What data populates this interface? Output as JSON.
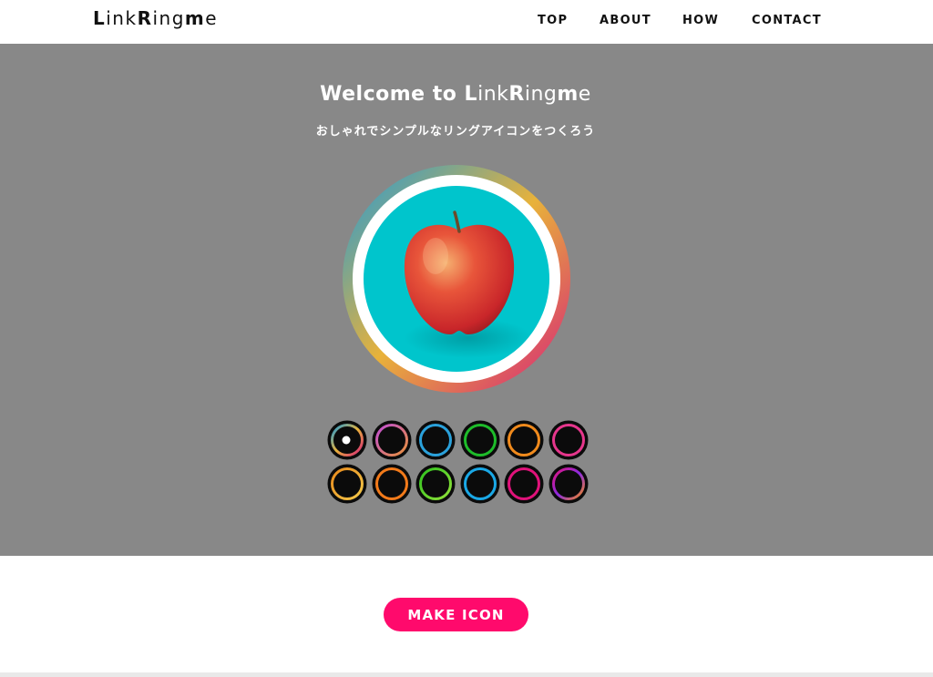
{
  "header": {
    "logo_parts": [
      "L",
      "ink",
      "R",
      "ing",
      "m",
      "e"
    ],
    "nav": [
      {
        "key": "top",
        "label": "TOP"
      },
      {
        "key": "about",
        "label": "ABOUT"
      },
      {
        "key": "how",
        "label": "HOW"
      },
      {
        "key": "contact",
        "label": "CONTACT"
      }
    ]
  },
  "hero": {
    "title_prefix": "Welcome to ",
    "title_parts": [
      "L",
      "ink",
      "R",
      "ing",
      "m",
      "e"
    ],
    "subtitle": "おしゃれでシンプルなリングアイコンをつくろう",
    "preview": {
      "image": "apple-on-teal-background",
      "ring_colors": [
        "#1e9ad9",
        "#e8b23a",
        "#d6207a"
      ],
      "background": "#00c5cc"
    },
    "swatches": [
      [
        {
          "colors": [
            "#1e9ad9",
            "#e8b23a",
            "#d6207a"
          ],
          "selected": true
        },
        {
          "colors": [
            "#c04ed6",
            "#e9913a"
          ],
          "selected": false
        },
        {
          "colors": [
            "#2aa1db",
            "#2aa1db"
          ],
          "selected": false
        },
        {
          "colors": [
            "#1ebc2a",
            "#1ebc2a"
          ],
          "selected": false
        },
        {
          "colors": [
            "#f08a1c",
            "#f08a1c"
          ],
          "selected": false
        },
        {
          "colors": [
            "#e6368c",
            "#e6368c"
          ],
          "selected": false
        }
      ],
      [
        {
          "colors": [
            "#e88a1c",
            "#f2c84a"
          ],
          "selected": false
        },
        {
          "colors": [
            "#f27a1a",
            "#f27a1a"
          ],
          "selected": false
        },
        {
          "colors": [
            "#2fc21f",
            "#92e23a"
          ],
          "selected": false
        },
        {
          "colors": [
            "#1aa8e6",
            "#1aa8e6"
          ],
          "selected": false
        },
        {
          "colors": [
            "#e0127a",
            "#e0127a"
          ],
          "selected": false
        },
        {
          "colors": [
            "#e0127a",
            "#8a2be2",
            "#f28c1a"
          ],
          "selected": false
        }
      ]
    ]
  },
  "cta": {
    "label": "MAKE ICON"
  },
  "colors": {
    "hero_bg": "#888888",
    "accent": "#ff0a6c",
    "text": "#111111"
  }
}
